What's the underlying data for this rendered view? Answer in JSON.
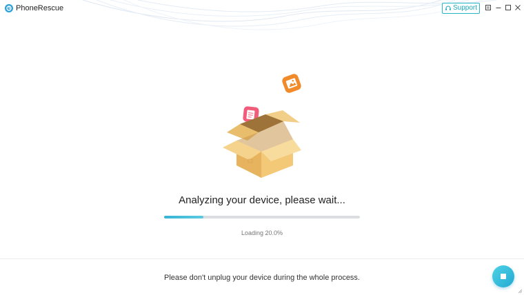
{
  "window": {
    "app_title": "PhoneRescue",
    "support_label": "Support"
  },
  "icons": {
    "app_logo": "phonerescue-logo-icon",
    "support": "headset-icon",
    "menu": "menu-icon",
    "minimize": "minimize-icon",
    "maximize": "maximize-icon",
    "close": "close-icon",
    "stop": "stop-icon"
  },
  "main": {
    "status_title": "Analyzing your device, please wait...",
    "progress": {
      "fraction": 0.2,
      "text": "Loading 20.0%"
    }
  },
  "footer": {
    "notice": "Please don't unplug your device during the whole process."
  },
  "colors": {
    "accent": "#21b7c6",
    "progress_fill": "#36b4d6",
    "progress_track": "#dcdde0"
  }
}
